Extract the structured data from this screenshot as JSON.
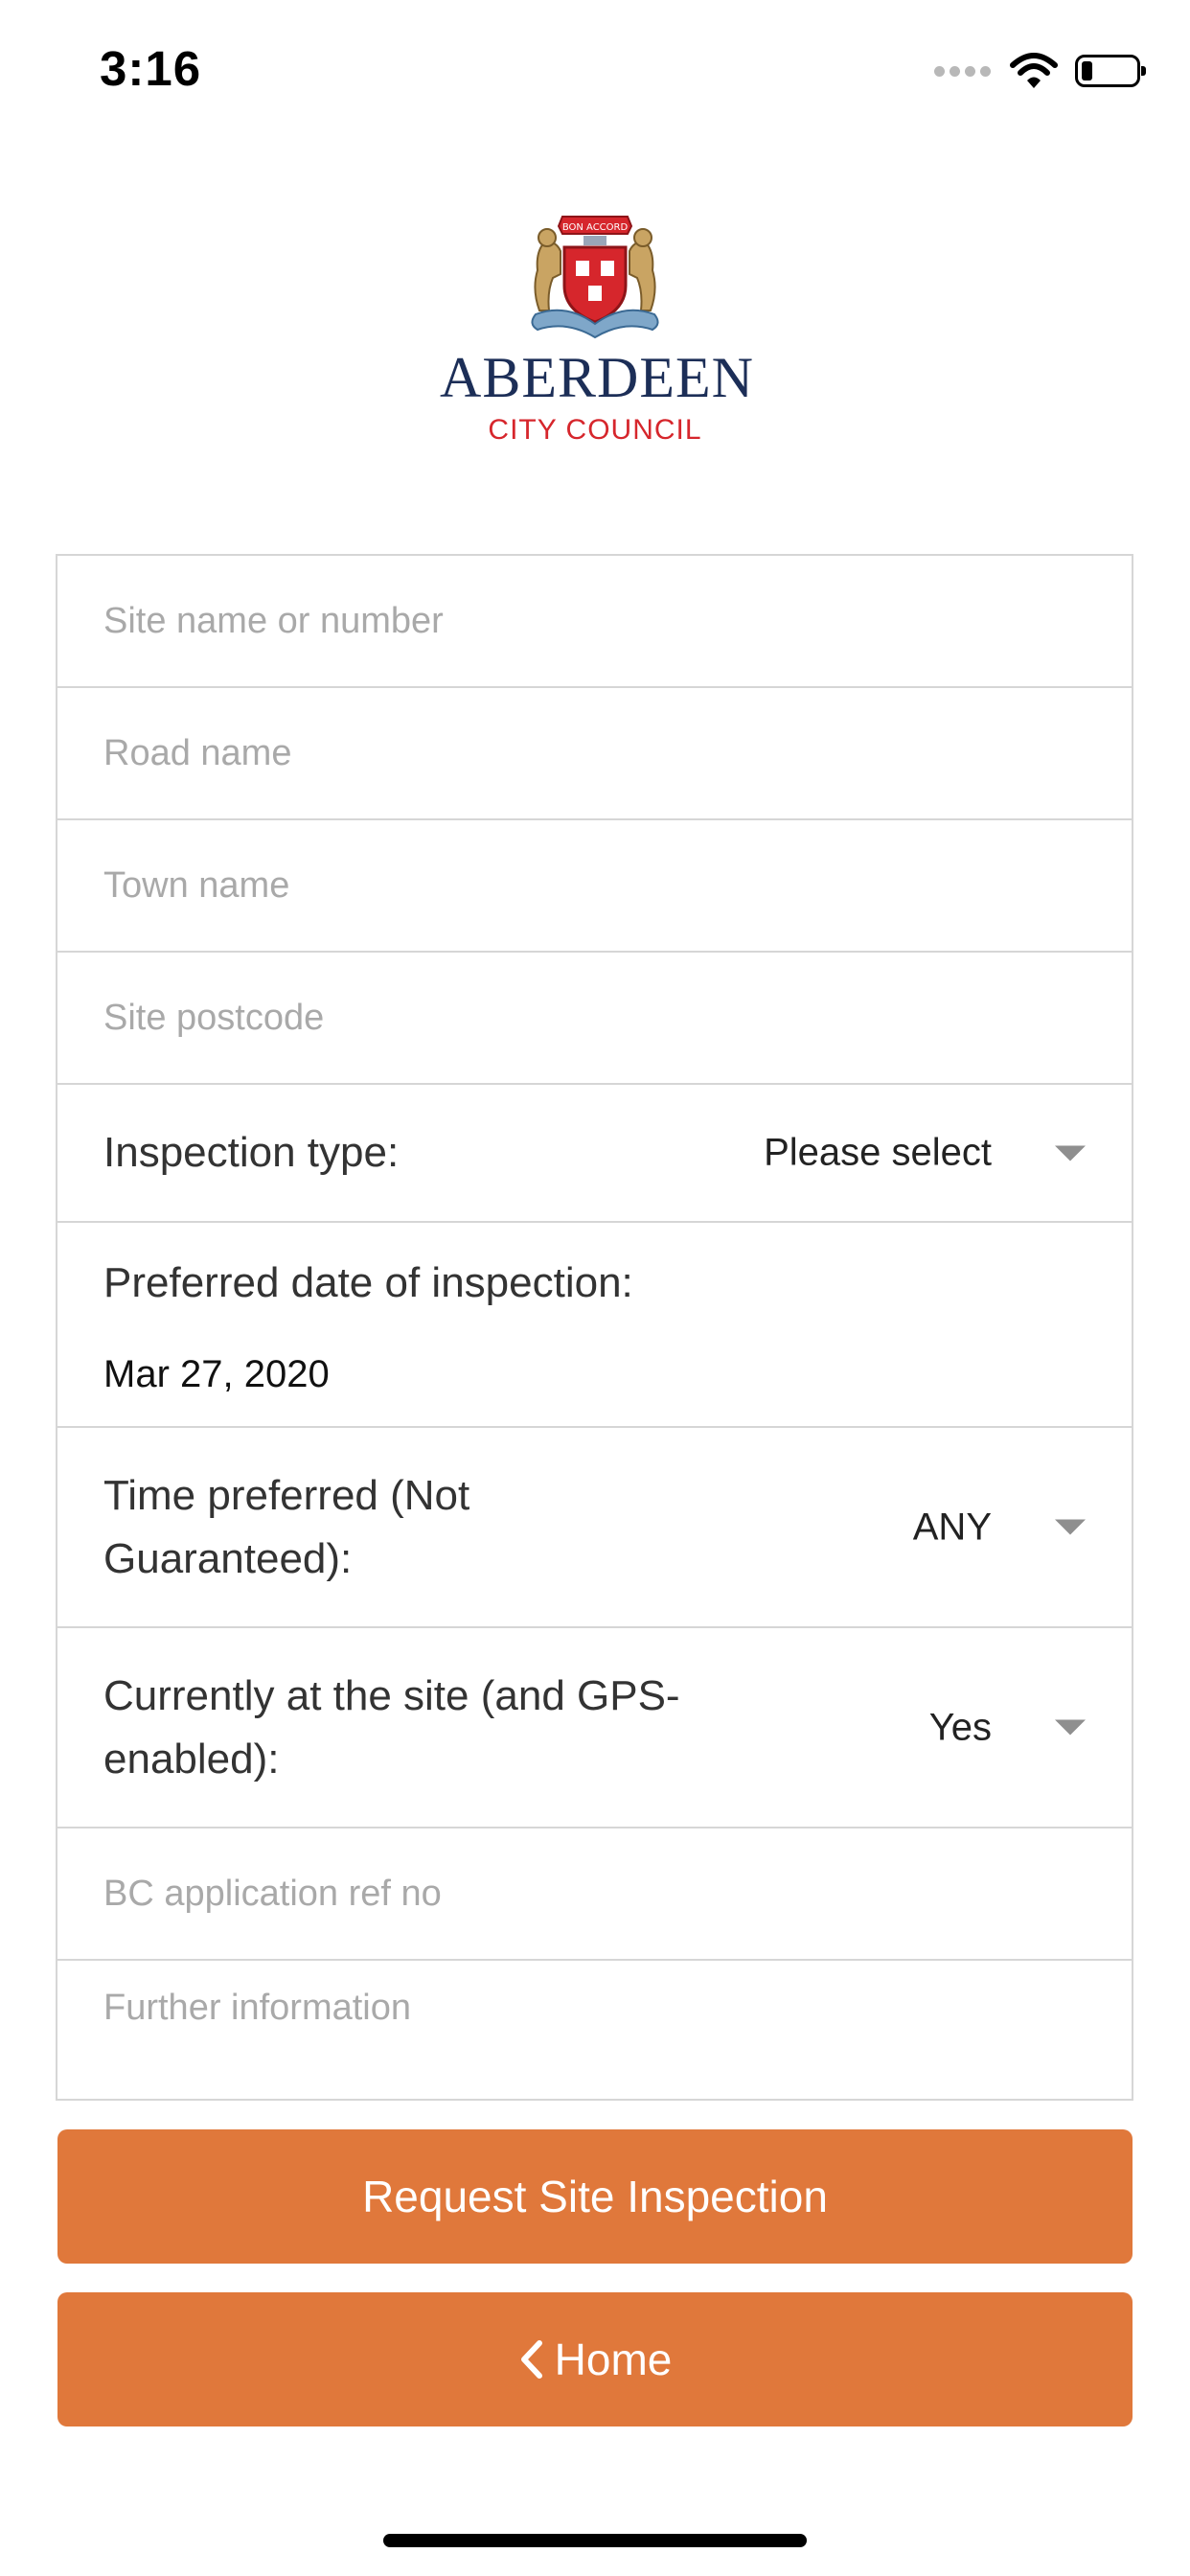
{
  "status_bar": {
    "time": "3:16",
    "battery_level": 0.2
  },
  "logo": {
    "title": "ABERDEEN",
    "subtitle": "CITY COUNCIL",
    "motto": "BON ACCORD",
    "colors": {
      "navy": "#1c2e57",
      "red": "#d6262c"
    }
  },
  "form": {
    "site_name": {
      "placeholder": "Site name or number",
      "value": ""
    },
    "road_name": {
      "placeholder": "Road name",
      "value": ""
    },
    "town_name": {
      "placeholder": "Town name",
      "value": ""
    },
    "site_postcode": {
      "placeholder": "Site postcode",
      "value": ""
    },
    "inspection_type": {
      "label": "Inspection type:",
      "value": "Please select"
    },
    "preferred_date": {
      "label": "Preferred date of inspection:",
      "value": "Mar 27, 2020"
    },
    "time_preferred": {
      "label": "Time preferred (Not Guaranteed):",
      "value": "ANY"
    },
    "currently_at_site": {
      "label": "Currently at the site (and GPS-enabled):",
      "value": "Yes"
    },
    "bc_ref": {
      "placeholder": "BC application ref no",
      "value": ""
    },
    "further_info": {
      "placeholder": "Further information",
      "value": ""
    }
  },
  "buttons": {
    "request": "Request Site Inspection",
    "home": "Home"
  },
  "colors": {
    "accent": "#e0783b",
    "border": "#d6d6d6",
    "placeholder": "#a9a9a9"
  },
  "icons": {
    "wifi": "wifi-icon",
    "battery": "battery-icon",
    "signal": "signal-dots-icon",
    "dropdown": "caret-down-icon",
    "back": "chevron-left-icon",
    "crest": "crest-icon"
  }
}
